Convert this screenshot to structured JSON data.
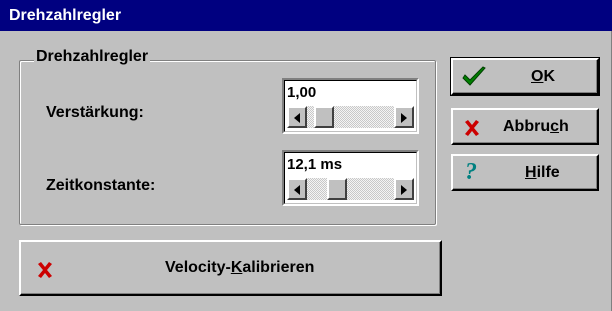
{
  "window": {
    "title": "Drehzahlregler"
  },
  "group": {
    "title": "Drehzahlregler",
    "gain": {
      "label": "Verstärkung:",
      "value": "1,00",
      "slider_position": 0.1
    },
    "time_constant": {
      "label": "Zeitkonstante:",
      "value": "12,1 ms",
      "slider_position": 0.3
    }
  },
  "buttons": {
    "ok": {
      "mnemonic": "O",
      "rest": "K",
      "icon": "check-icon",
      "color": "#008000"
    },
    "cancel": {
      "prefix": "Abbru",
      "mnemonic": "c",
      "rest": "h",
      "icon": "x-icon",
      "color": "#cc0000"
    },
    "help": {
      "mnemonic": "H",
      "rest": "ilfe",
      "icon": "question-icon",
      "color": "#008080"
    },
    "calibrate": {
      "prefix": "Velocity-",
      "mnemonic": "K",
      "rest": "alibrieren",
      "icon": "x-icon",
      "color": "#cc0000"
    }
  }
}
